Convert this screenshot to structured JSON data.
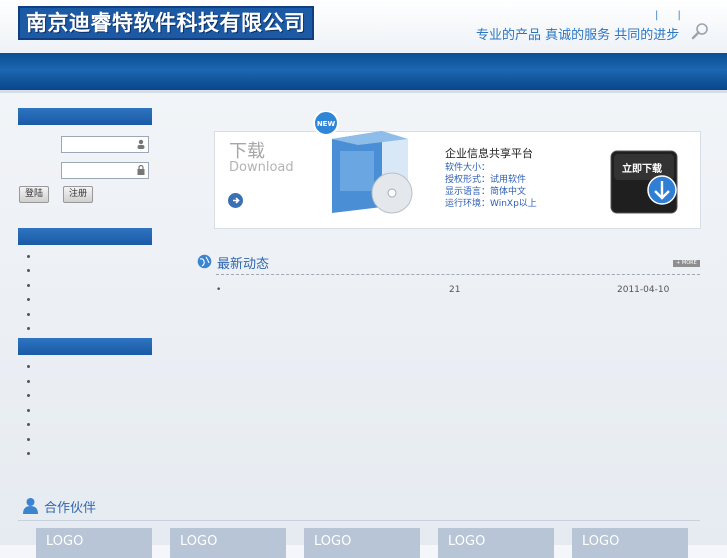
{
  "header": {
    "company": "南京迪睿特软件科技有限公司",
    "links": "| |",
    "slogan": "专业的产品 真诚的服务 共同的进步"
  },
  "login": {
    "login_btn": "登陆",
    "register_btn": "注册"
  },
  "download": {
    "title": "下载",
    "subtitle": "Download",
    "product_name": "企业信息共享平台",
    "lines": [
      "软件大小：",
      "授权形式：试用软件",
      "显示语言：简体中文",
      "运行环境：WinXp以上"
    ],
    "badge": "NEW",
    "button_label": "立即下载"
  },
  "news": {
    "title": "最新动态",
    "more": "+ MORE",
    "items": [
      {
        "bullet": "•",
        "title": "21",
        "date": "2011-04-10"
      }
    ]
  },
  "partners": {
    "title": "合作伙伴",
    "logos": [
      "LOGO",
      "LOGO",
      "LOGO",
      "LOGO",
      "LOGO"
    ]
  },
  "colors": {
    "brand": "#1d5aa5",
    "accent": "#2b77c2"
  }
}
